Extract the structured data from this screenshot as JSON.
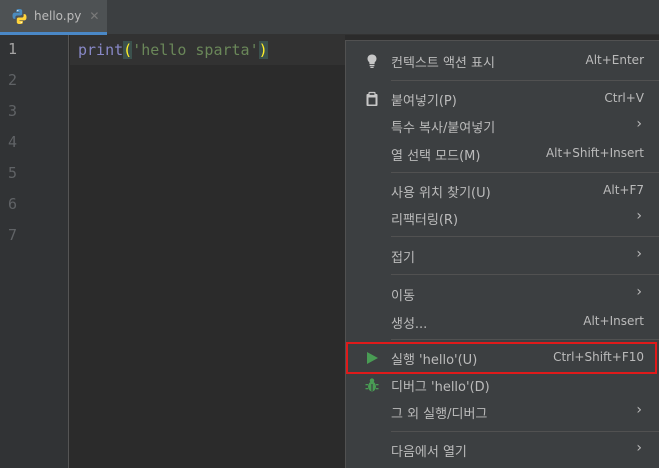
{
  "tab": {
    "filename": "hello.py",
    "close_glyph": "✕",
    "icon": "python-file-icon"
  },
  "gutter": {
    "lines": [
      "1",
      "2",
      "3",
      "4",
      "5",
      "6",
      "7"
    ]
  },
  "editor": {
    "fn": "print",
    "open_paren": "(",
    "string": "'hello sparta'",
    "close_paren": ")"
  },
  "menu": {
    "items": [
      {
        "label": "컨텍스트 액션 표시",
        "shortcut": "Alt+Enter",
        "icon": "lightbulb-icon"
      },
      {
        "label": "붙여넣기(P)",
        "shortcut": "Ctrl+V",
        "icon": "clipboard-icon"
      },
      {
        "label": "특수 복사/붙여넣기",
        "submenu": "›"
      },
      {
        "label": "열 선택 모드(M)",
        "shortcut": "Alt+Shift+Insert"
      },
      {
        "label": "사용 위치 찾기(U)",
        "shortcut": "Alt+F7"
      },
      {
        "label": "리팩터링(R)",
        "submenu": "›"
      },
      {
        "label": "접기",
        "submenu": "›"
      },
      {
        "label": "이동",
        "submenu": "›"
      },
      {
        "label": "생성...",
        "shortcut": "Alt+Insert"
      },
      {
        "label": "실행 'hello'(U)",
        "shortcut": "Ctrl+Shift+F10",
        "icon": "run-icon"
      },
      {
        "label": "디버그 'hello'(D)",
        "icon": "debug-bug-icon"
      },
      {
        "label": "그 외 실행/디버그",
        "submenu": "›"
      },
      {
        "label": "다음에서 열기",
        "submenu": "›"
      }
    ]
  },
  "colors": {
    "run_green": "#499c54",
    "highlight_red": "#e01a1a"
  }
}
